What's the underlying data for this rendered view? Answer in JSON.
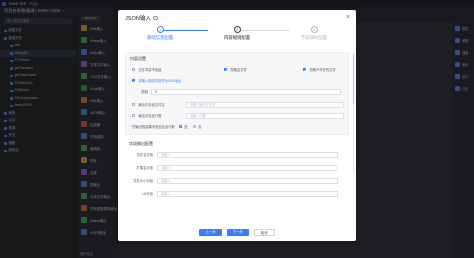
{
  "app": {
    "title": "DWS IDE",
    "title_tag": "开发版",
    "breadcrumb": "项目名称/数据湖 / testR / ODS",
    "search_placeholder": "输入关键字搜索",
    "tree": [
      {
        "label": "新建文件",
        "active": false
      },
      {
        "label": "集成开发",
        "active": false
      },
      {
        "label": "test",
        "active": false
      },
      {
        "label": "DRInput",
        "active": true
      },
      {
        "label": "FTPDemo",
        "active": false
      },
      {
        "label": "getFilename",
        "active": false
      },
      {
        "label": "getTableName",
        "active": false
      },
      {
        "label": "JSONDemo",
        "active": false
      },
      {
        "label": "POIExcel",
        "active": false
      },
      {
        "label": "POIJsonLoader",
        "active": false
      },
      {
        "label": "testtuJSON",
        "active": false
      },
      {
        "label": "我的",
        "active": false
      },
      {
        "label": "公共",
        "active": false
      },
      {
        "label": "资源",
        "active": false
      },
      {
        "label": "作业",
        "active": false
      },
      {
        "label": "函数",
        "active": false
      },
      {
        "label": "回收站",
        "active": false
      }
    ],
    "canvas_tab": "DRInput",
    "palette": [
      {
        "label": "Hive输入",
        "color": "#e0a33b"
      },
      {
        "label": "Hbase输入",
        "color": "#4fb36a"
      },
      {
        "label": "Kafka输入",
        "color": "#5b8def"
      },
      {
        "label": "文本文件输入",
        "color": "#9b6cd8"
      },
      {
        "label": "CSV文件输入",
        "color": "#4fb36a"
      },
      {
        "label": "Excel输入",
        "color": "#3fa35a"
      },
      {
        "label": "XML输入",
        "color": "#e07a3b"
      },
      {
        "label": "JSON输入",
        "color": "#5b8def"
      },
      {
        "label": "过滤器",
        "color": "#d95b5b"
      },
      {
        "label": "字段选择",
        "color": "#5b8def"
      },
      {
        "label": "值映射",
        "color": "#4fb36a"
      },
      {
        "label": "排序",
        "color": "#e0a33b"
      },
      {
        "label": "去重",
        "color": "#9b6cd8"
      },
      {
        "label": "表输出",
        "color": "#5b8def"
      },
      {
        "label": "文本文件输出",
        "color": "#4fb36a"
      },
      {
        "label": "关系型数据库输出",
        "color": "#e07a3b"
      },
      {
        "label": "Hbase输出",
        "color": "#4fb36a"
      },
      {
        "label": "HDFS输出",
        "color": "#5b8def"
      }
    ],
    "right_strip": [
      "属性",
      "参数",
      "调度",
      "版本",
      "运行",
      "日志"
    ],
    "status": "运行日志"
  },
  "modal": {
    "title": "JSON输入",
    "close_icon": "close-icon",
    "steps": [
      {
        "num": "1",
        "label": "基础信息配置",
        "state": "done"
      },
      {
        "num": "2",
        "label": "内容规则配置",
        "state": "current"
      },
      {
        "num": "3",
        "label": "字段映射配置",
        "state": "todo"
      }
    ],
    "content_section": {
      "title": "内容设置",
      "checks_row1": [
        {
          "label": "文件内容不加锁",
          "checked": false
        },
        {
          "label": "忽略空文件",
          "checked": true
        },
        {
          "label": "忽略不存在的文件",
          "checked": true
        }
      ],
      "check_url": {
        "label": "将输入源的内容作为URL地址",
        "checked": true
      },
      "limit_label": "限制",
      "limit_value": "0",
      "check_filename": {
        "label": "输出中包含文件名",
        "checked": false
      },
      "filename_placeholder": "请输入输出文件名",
      "check_rownum": {
        "label": "输出中包含行数",
        "checked": false
      },
      "rownum_placeholder": "请输入行数",
      "reset_label": "在输出的结果中是否包含行数",
      "radios": [
        {
          "label": "是",
          "checked": true
        },
        {
          "label": "否",
          "checked": false
        }
      ]
    },
    "field_section": {
      "title": "字段输出配置",
      "fields": [
        {
          "label": "文件名字段",
          "placeholder": "请输入"
        },
        {
          "label": "扩展名字段",
          "placeholder": "请输入"
        },
        {
          "label": "文件大小字段",
          "placeholder": "请输入"
        },
        {
          "label": "Uri字段",
          "placeholder": "请输入"
        }
      ]
    },
    "buttons": {
      "prev": "上一步",
      "next": "下一步",
      "cancel": "取消"
    }
  }
}
